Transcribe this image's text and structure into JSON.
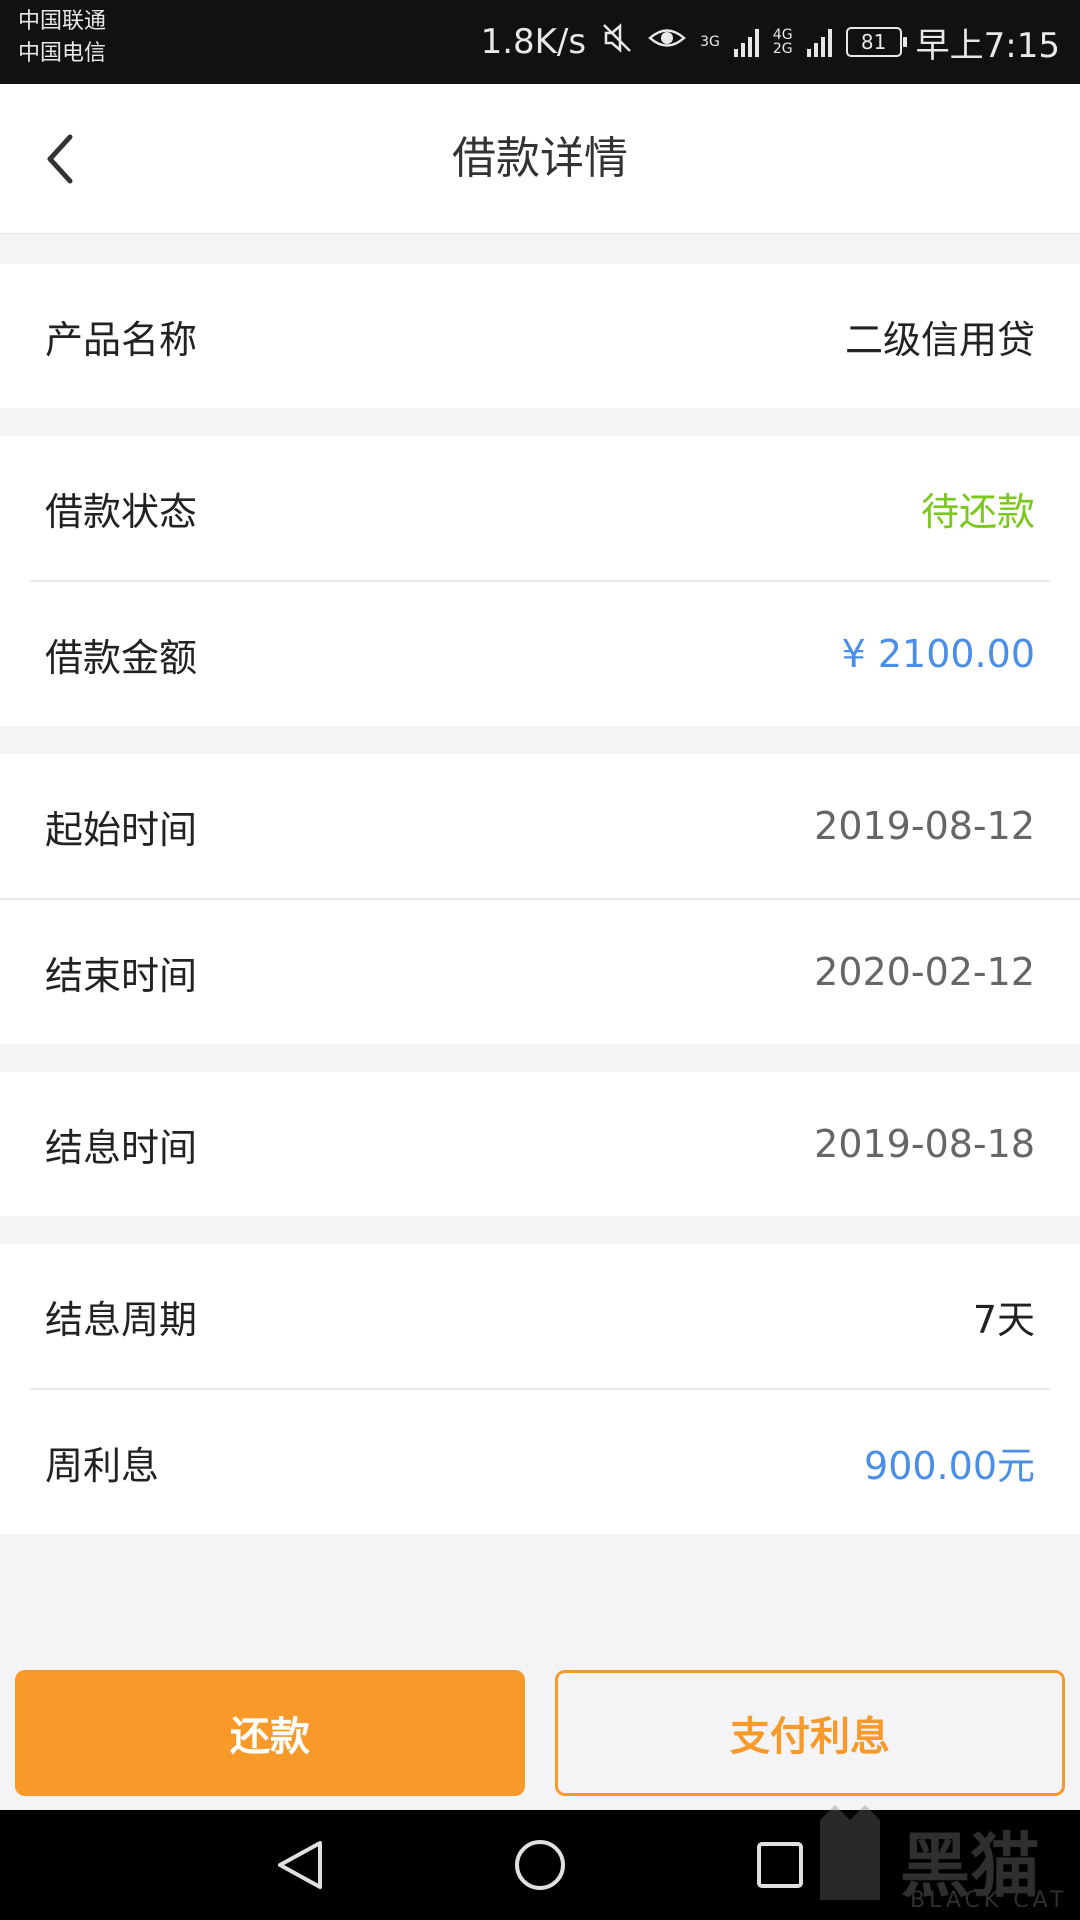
{
  "status_bar": {
    "carrier1": "中国联通",
    "carrier2": "中国电信",
    "speed": "1.8K/s",
    "net1": "3G",
    "net2a": "4G",
    "net2b": "2G",
    "battery": "81",
    "time": "早上7:15"
  },
  "header": {
    "title": "借款详情"
  },
  "details": {
    "product_name_label": "产品名称",
    "product_name_value": "二级信用贷",
    "status_label": "借款状态",
    "status_value": "待还款",
    "amount_label": "借款金额",
    "amount_value": "¥ 2100.00",
    "start_label": "起始时间",
    "start_value": "2019-08-12",
    "end_label": "结束时间",
    "end_value": "2020-02-12",
    "settle_label": "结息时间",
    "settle_value": "2019-08-18",
    "period_label": "结息周期",
    "period_value": "7天",
    "weekly_interest_label": "周利息",
    "weekly_interest_value": "900.00元"
  },
  "actions": {
    "repay_label": "还款",
    "pay_interest_label": "支付利息"
  },
  "watermark": {
    "text": "黑猫",
    "sub": "BLACK CAT"
  },
  "colors": {
    "accent": "#f79a2a",
    "status_green": "#7ac81e",
    "amount_blue": "#4a8ee8",
    "date_gray": "#666666"
  }
}
